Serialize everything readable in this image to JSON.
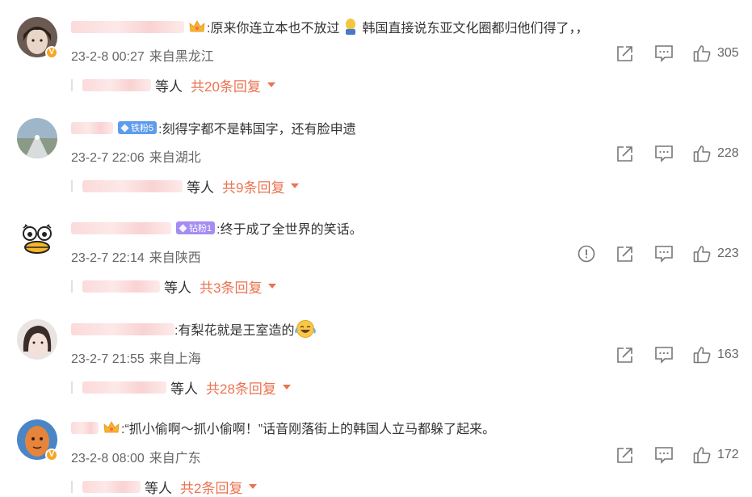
{
  "comments": [
    {
      "text": ":原来你连立本也不放过",
      "text2": "韩国直接说东亚文化圈都归他们得了，，",
      "time": "23-2-8 00:27",
      "location": "来自黑龙江",
      "likes": "305",
      "reply_suffix": "等人",
      "reply_count": "共20条回复"
    },
    {
      "badge": "铁粉5",
      "text": ":刻得字都不是韩国字，还有脸申遗",
      "time": "23-2-7 22:06",
      "location": "来自湖北",
      "likes": "228",
      "reply_suffix": "等人",
      "reply_count": "共9条回复"
    },
    {
      "badge": "钻粉1",
      "text": ":终于成了全世界的笑话。",
      "time": "23-2-7 22:14",
      "location": "来自陕西",
      "likes": "223",
      "reply_suffix": "等人",
      "reply_count": "共3条回复"
    },
    {
      "text": ":有梨花就是王室造的",
      "time": "23-2-7 21:55",
      "location": "来自上海",
      "likes": "163",
      "reply_suffix": "等人",
      "reply_count": "共28条回复"
    },
    {
      "text": ":“抓小偷啊～抓小偷啊！”话音刚落街上的韩国人立马都躲了起来。",
      "time": "23-2-8 08:00",
      "location": "来自广东",
      "likes": "172",
      "reply_suffix": "等人",
      "reply_count": "共2条回复"
    }
  ],
  "colors": {
    "accent": "#eb7350",
    "badge_blue": "#5d9cec",
    "badge_purple": "#a58cf2",
    "vip_orange": "#f5a623"
  },
  "icons": [
    "crown-icon",
    "repost-icon",
    "comment-icon",
    "like-icon",
    "report-icon",
    "chevron-down-icon",
    "verified-icon",
    "emoji-laugh-cry-icon",
    "emoji-figure-icon"
  ]
}
